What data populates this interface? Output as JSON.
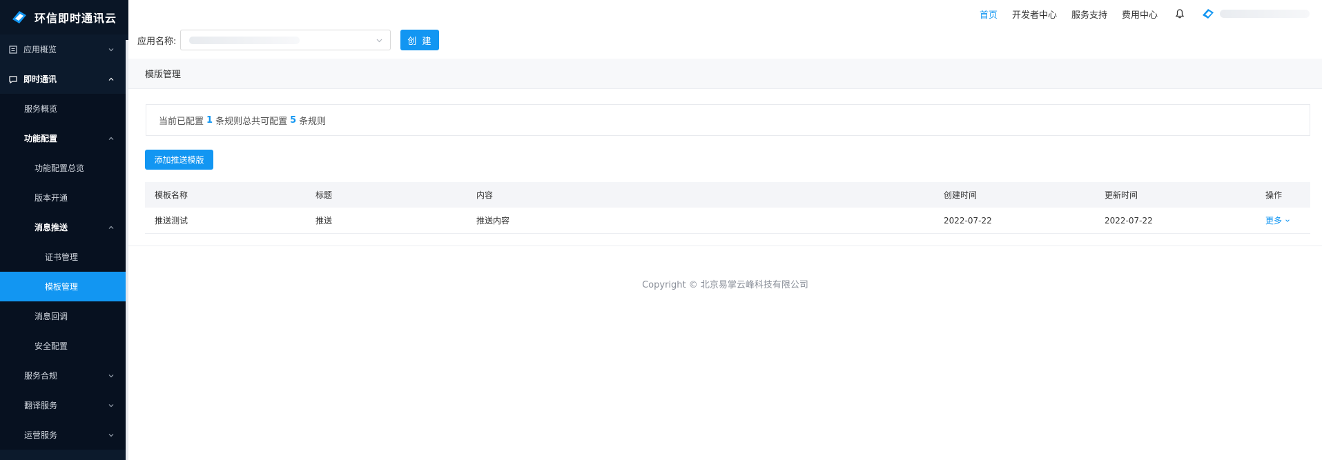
{
  "app": {
    "title": "环信即时通讯云"
  },
  "sidebar": {
    "items": [
      {
        "label": "应用概览"
      },
      {
        "label": "即时通讯"
      },
      {
        "label": "服务概览"
      },
      {
        "label": "功能配置"
      },
      {
        "label": "功能配置总览"
      },
      {
        "label": "版本开通"
      },
      {
        "label": "消息推送"
      },
      {
        "label": "证书管理"
      },
      {
        "label": "模板管理"
      },
      {
        "label": "消息回调"
      },
      {
        "label": "安全配置"
      },
      {
        "label": "服务合规"
      },
      {
        "label": "翻译服务"
      },
      {
        "label": "运营服务"
      }
    ],
    "active": "模板管理"
  },
  "topnav": {
    "links": [
      "首页",
      "开发者中心",
      "服务支持",
      "费用中心"
    ],
    "active": "首页"
  },
  "app_selector": {
    "label": "应用名称:",
    "create_label": "创 建"
  },
  "page": {
    "title": "模版管理",
    "info": {
      "prefix": "当前已配置",
      "configured": "1",
      "middle": "条规则总共可配置",
      "total": "5",
      "suffix": "条规则"
    },
    "add_button": "添加推送模版",
    "table": {
      "headers": [
        "模板名称",
        "标题",
        "内容",
        "创建时间",
        "更新时间",
        "操作"
      ],
      "rows": [
        {
          "name": "推送测试",
          "title": "推送",
          "content": "推送内容",
          "created": "2022-07-22",
          "updated": "2022-07-22",
          "action": "更多"
        }
      ]
    }
  },
  "footer": {
    "text": "Copyright © 北京易掌云峰科技有限公司"
  },
  "colors": {
    "accent": "#1296f2",
    "sidebar_bg": "#0c1a2c",
    "sidebar_sub_bg": "#071120"
  }
}
